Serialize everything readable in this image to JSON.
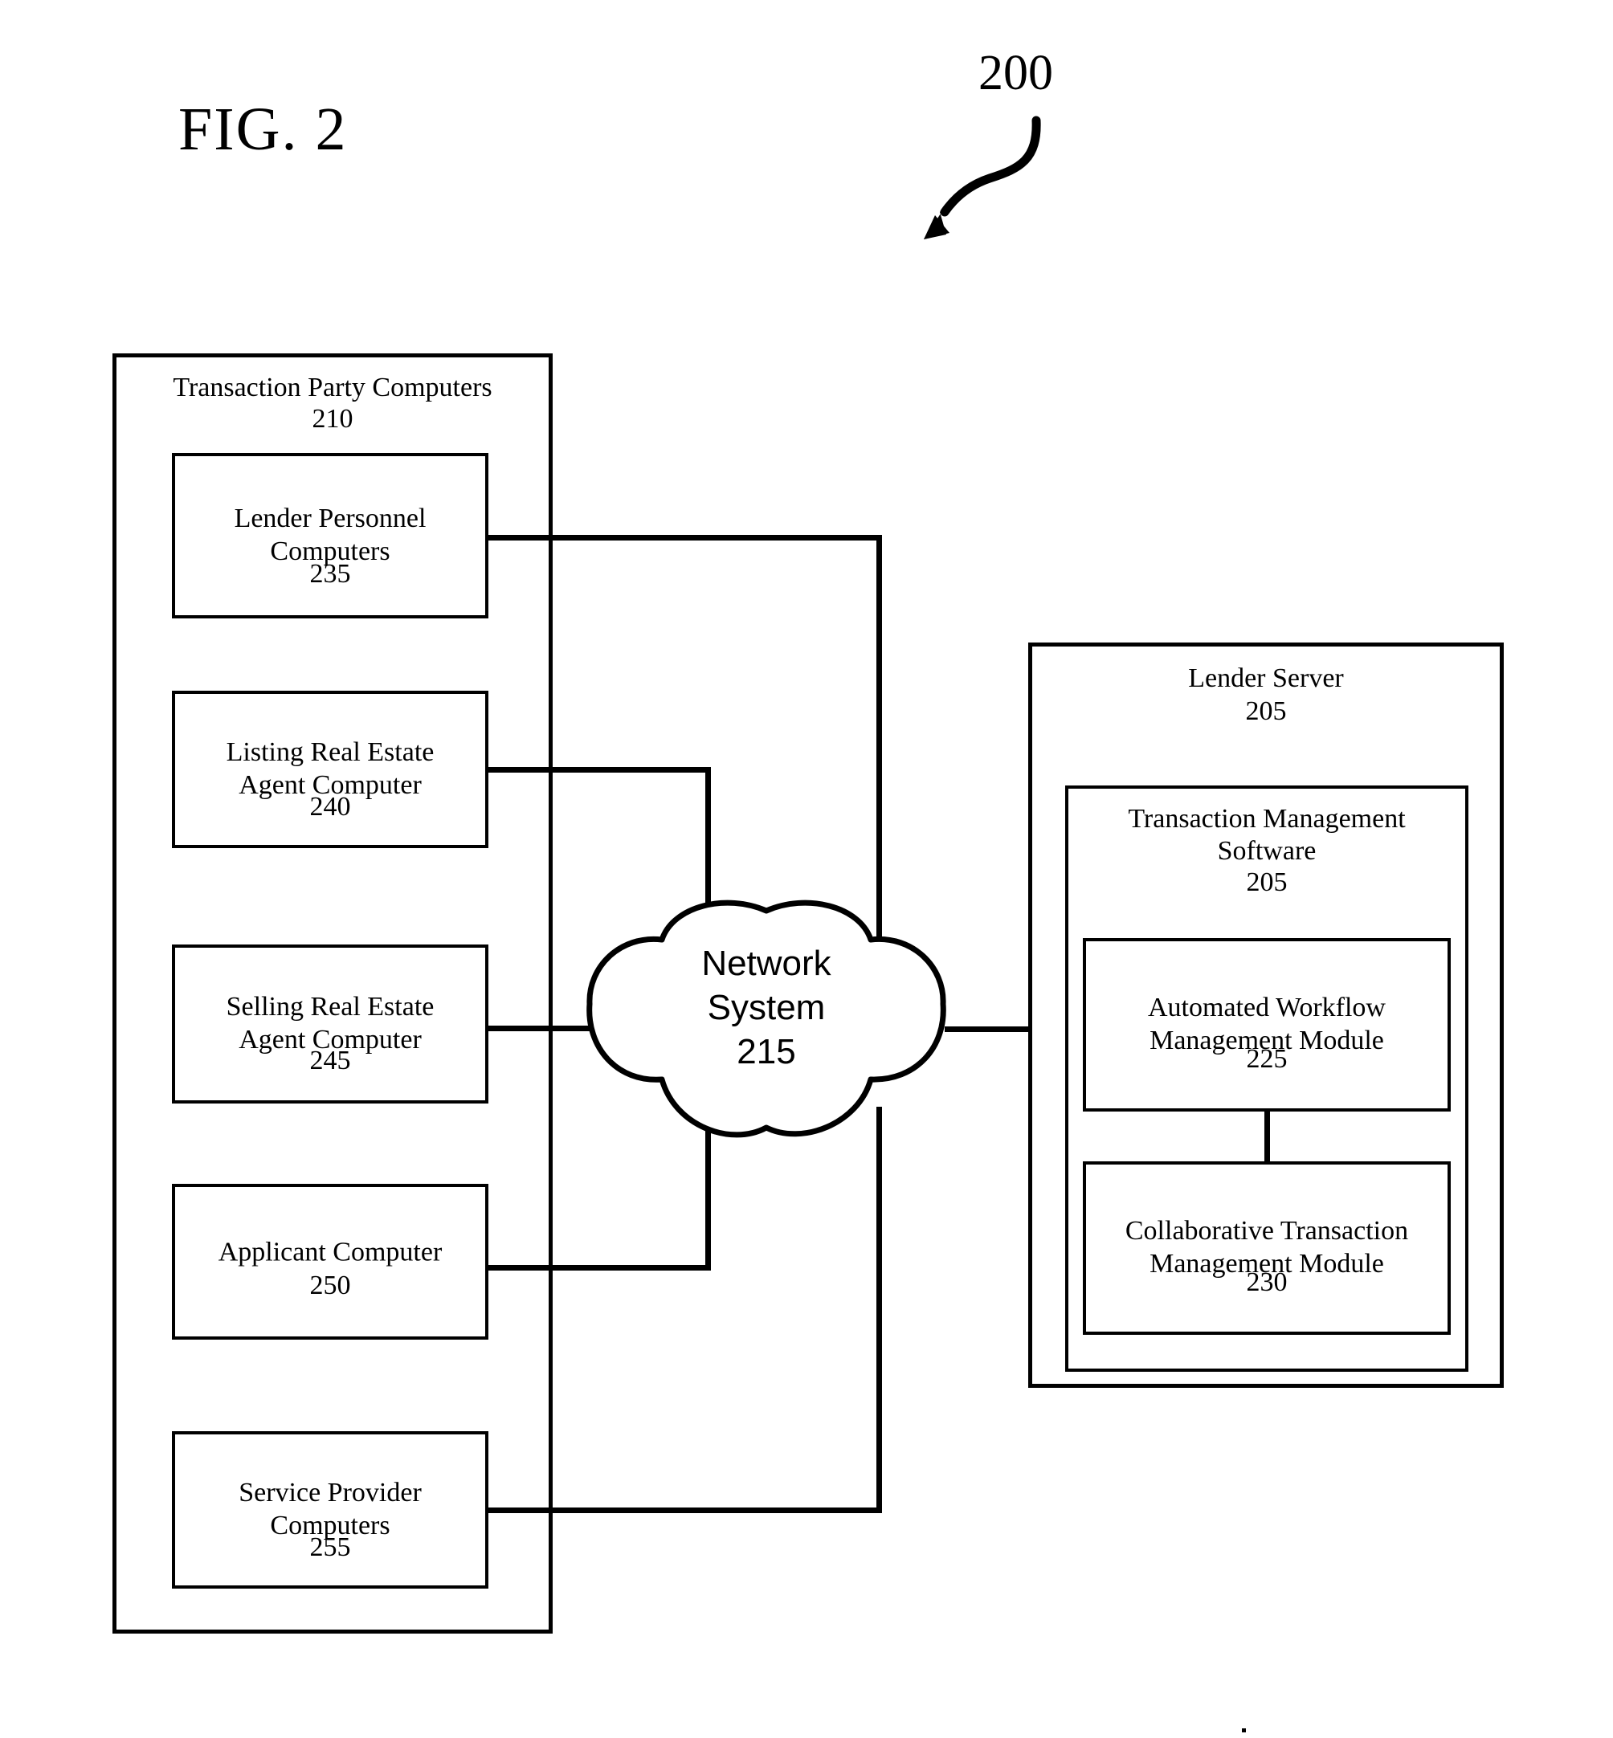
{
  "figure": {
    "title": "FIG. 2",
    "reference_numeral": "200"
  },
  "left_container": {
    "title": "Transaction Party Computers",
    "number": "210",
    "items": [
      {
        "label": "Lender Personnel\nComputers",
        "number": "235"
      },
      {
        "label": "Listing Real Estate\nAgent Computer",
        "number": "240"
      },
      {
        "label": "Selling Real Estate\nAgent Computer",
        "number": "245"
      },
      {
        "label": "Applicant Computer",
        "number": "250"
      },
      {
        "label": "Service Provider\nComputers",
        "number": "255"
      }
    ]
  },
  "network": {
    "label": "Network\nSystem\n215",
    "name": "Network System",
    "number": "215"
  },
  "right_container": {
    "title": "Lender Server",
    "number": "205",
    "software": {
      "title": "Transaction Management\nSoftware",
      "number": "205",
      "modules": [
        {
          "label": "Automated Workflow\nManagement Module",
          "number": "225"
        },
        {
          "label": "Collaborative Transaction\nManagement Module",
          "number": "230"
        }
      ]
    }
  },
  "colors": {
    "ink": "#000000",
    "paper": "#ffffff"
  }
}
